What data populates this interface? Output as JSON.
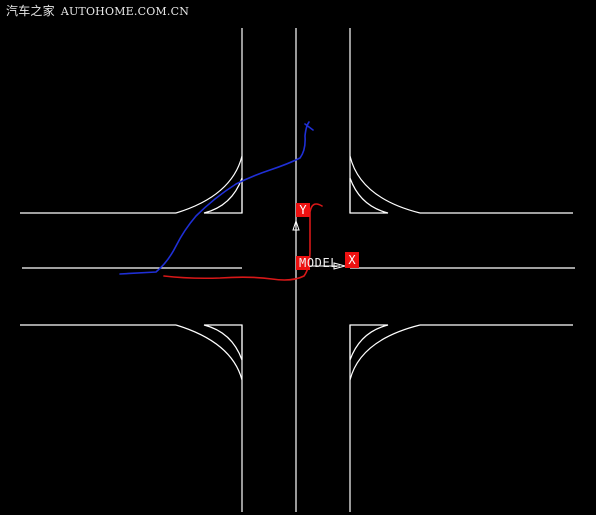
{
  "watermark": {
    "brand_cn": "汽车之家",
    "site": "AUTOHOME.COM.CN"
  },
  "ucs": {
    "y_axis_label": "Y",
    "x_axis_label": "X",
    "space_label": "MODEL"
  },
  "colors": {
    "background": "#000000",
    "geometry": "#ffffff",
    "annotation_blue": "#1f2fd6",
    "annotation_red": "#d81818",
    "badge": "#e11111"
  }
}
